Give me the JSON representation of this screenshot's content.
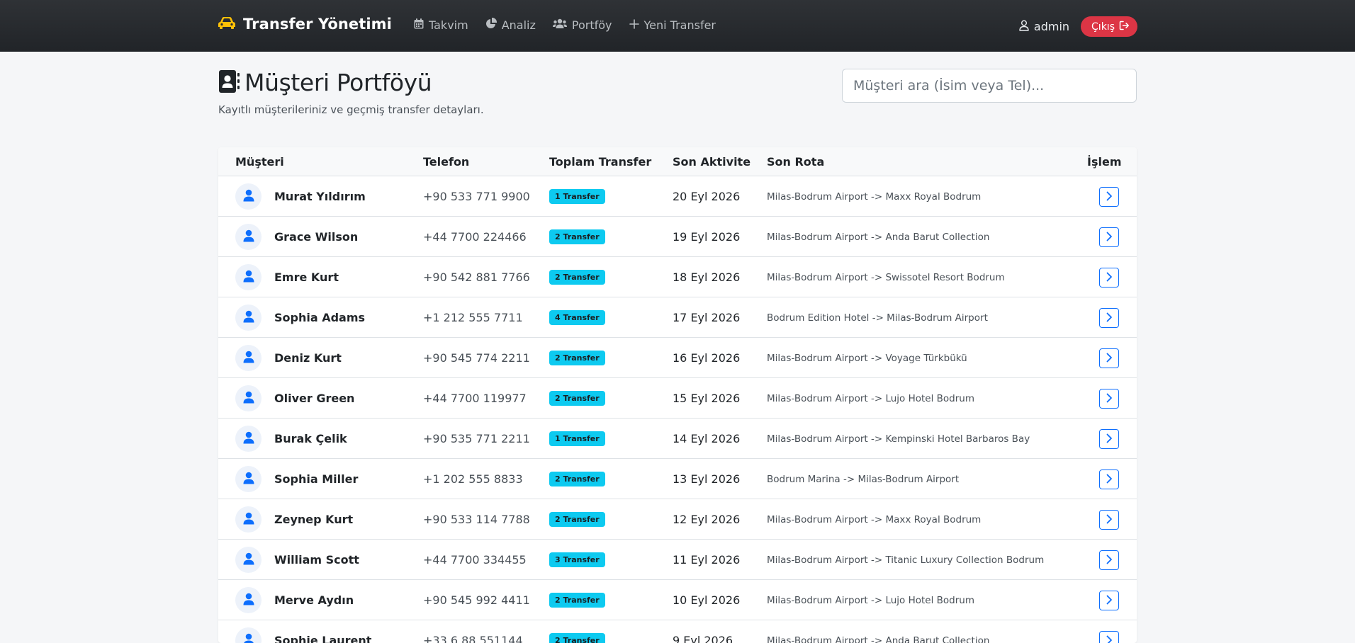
{
  "navbar": {
    "brand": "Transfer Yönetimi",
    "brand_icon": "car-icon",
    "links": [
      {
        "label": "Takvim",
        "icon": "calendar-icon"
      },
      {
        "label": "Analiz",
        "icon": "pie-chart-icon"
      },
      {
        "label": "Portföy",
        "icon": "users-icon"
      },
      {
        "label": "Yeni Transfer",
        "icon": "plus-icon"
      }
    ],
    "user": "admin",
    "logout_label": "Çıkış"
  },
  "colors": {
    "navbar_bg": "#212428",
    "brand_icon": "#ffc107",
    "badge": "#0dcaf0",
    "logout": "#dc3545",
    "primary": "#0d6efd"
  },
  "page": {
    "title": "Müşteri Portföyü",
    "subtitle": "Kayıtlı müşterileriniz ve geçmiş transfer detayları.",
    "search_placeholder": "Müşteri ara (İsim veya Tel)..."
  },
  "table": {
    "headers": {
      "customer": "Müşteri",
      "phone": "Telefon",
      "total": "Toplam Transfer",
      "last_activity": "Son Aktivite",
      "last_route": "Son Rota",
      "action": "İşlem"
    },
    "rows": [
      {
        "name": "Murat Yıldırım",
        "phone": "+90 533 771 9900",
        "transfers": "1 Transfer",
        "date": "20 Eyl 2026",
        "route": "Milas-Bodrum Airport -> Maxx Royal Bodrum"
      },
      {
        "name": "Grace Wilson",
        "phone": "+44 7700 224466",
        "transfers": "2 Transfer",
        "date": "19 Eyl 2026",
        "route": "Milas-Bodrum Airport -> Anda Barut Collection"
      },
      {
        "name": "Emre Kurt",
        "phone": "+90 542 881 7766",
        "transfers": "2 Transfer",
        "date": "18 Eyl 2026",
        "route": "Milas-Bodrum Airport -> Swissotel Resort Bodrum"
      },
      {
        "name": "Sophia Adams",
        "phone": "+1 212 555 7711",
        "transfers": "4 Transfer",
        "date": "17 Eyl 2026",
        "route": "Bodrum Edition Hotel -> Milas-Bodrum Airport"
      },
      {
        "name": "Deniz Kurt",
        "phone": "+90 545 774 2211",
        "transfers": "2 Transfer",
        "date": "16 Eyl 2026",
        "route": "Milas-Bodrum Airport -> Voyage Türkbükü"
      },
      {
        "name": "Oliver Green",
        "phone": "+44 7700 119977",
        "transfers": "2 Transfer",
        "date": "15 Eyl 2026",
        "route": "Milas-Bodrum Airport -> Lujo Hotel Bodrum"
      },
      {
        "name": "Burak Çelik",
        "phone": "+90 535 771 2211",
        "transfers": "1 Transfer",
        "date": "14 Eyl 2026",
        "route": "Milas-Bodrum Airport -> Kempinski Hotel Barbaros Bay"
      },
      {
        "name": "Sophia Miller",
        "phone": "+1 202 555 8833",
        "transfers": "2 Transfer",
        "date": "13 Eyl 2026",
        "route": "Bodrum Marina -> Milas-Bodrum Airport"
      },
      {
        "name": "Zeynep Kurt",
        "phone": "+90 533 114 7788",
        "transfers": "2 Transfer",
        "date": "12 Eyl 2026",
        "route": "Milas-Bodrum Airport -> Maxx Royal Bodrum"
      },
      {
        "name": "William Scott",
        "phone": "+44 7700 334455",
        "transfers": "3 Transfer",
        "date": "11 Eyl 2026",
        "route": "Milas-Bodrum Airport -> Titanic Luxury Collection Bodrum"
      },
      {
        "name": "Merve Aydın",
        "phone": "+90 545 992 4411",
        "transfers": "2 Transfer",
        "date": "10 Eyl 2026",
        "route": "Milas-Bodrum Airport -> Lujo Hotel Bodrum"
      },
      {
        "name": "Sophie Laurent",
        "phone": "+33 6 88 551144",
        "transfers": "2 Transfer",
        "date": "9 Eyl 2026",
        "route": "Milas-Bodrum Airport -> Anda Barut Collection"
      }
    ]
  }
}
